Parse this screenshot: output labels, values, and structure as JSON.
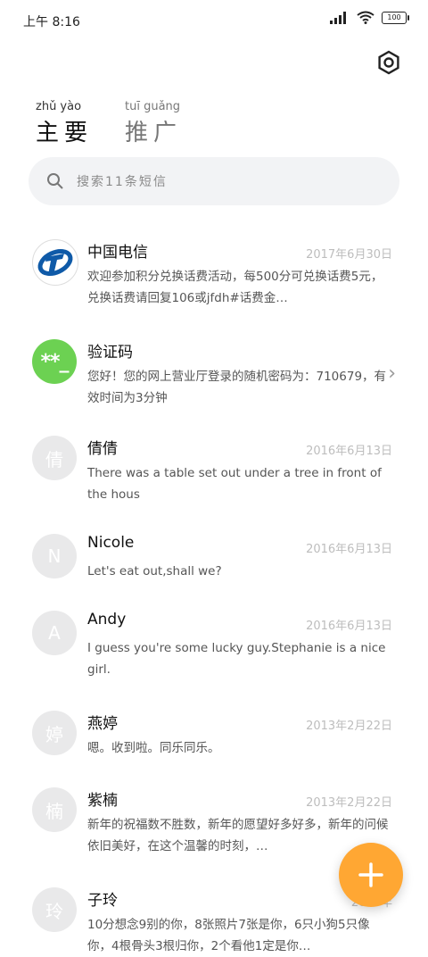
{
  "status": {
    "time": "上午 8:16",
    "battery": "100"
  },
  "tabs": [
    {
      "pinyin": "zhǔ yào",
      "label": "主要"
    },
    {
      "pinyin": "tuī guǎng",
      "label": "推广"
    }
  ],
  "search": {
    "pinyin": "sōu suǒ 11 tiáo duǎn xìn",
    "placeholder": "搜索11条短信"
  },
  "messages": [
    {
      "name": "中国电信",
      "date": "2017年6月30日",
      "preview": "欢迎参加积分兑换话费活动，每500分可兑换话费5元，兑换话费请回复106或jfdh#话费金…"
    },
    {
      "name": "验证码",
      "date": "",
      "preview": "您好！您的网上营业厅登录的随机密码为：710679，有效时间为3分钟"
    },
    {
      "name": "倩倩",
      "date": "2016年6月13日",
      "preview": "There was a table set out under a tree in front of the hous"
    },
    {
      "name": "Nicole",
      "date": "2016年6月13日",
      "preview": "Let's eat out,shall we?"
    },
    {
      "name": "Andy",
      "date": "2016年6月13日",
      "preview": "I guess you're some lucky guy.Stephanie is a nice girl."
    },
    {
      "name": "燕婷",
      "date": "2013年2月22日",
      "preview": "嗯。收到啦。同乐同乐。"
    },
    {
      "name": "紫楠",
      "date": "2013年2月22日",
      "preview": "新年的祝福数不胜数，新年的愿望好多好多，新年的问候依旧美好，在这个温馨的时刻，…"
    },
    {
      "name": "子玲",
      "date": "2013年",
      "preview": "10分想念9别的你，8张照片7张是你，6只小狗5只像你，4根骨头3根归你，2个看他1定是你…"
    }
  ],
  "avatars": [
    "",
    "**_",
    "倩",
    "N",
    "A",
    "婷",
    "楠",
    "玲"
  ],
  "colors": {
    "accent": "#ffa733",
    "verify_avatar": "#6cd152",
    "telecom_blue": "#0f5aa8"
  }
}
